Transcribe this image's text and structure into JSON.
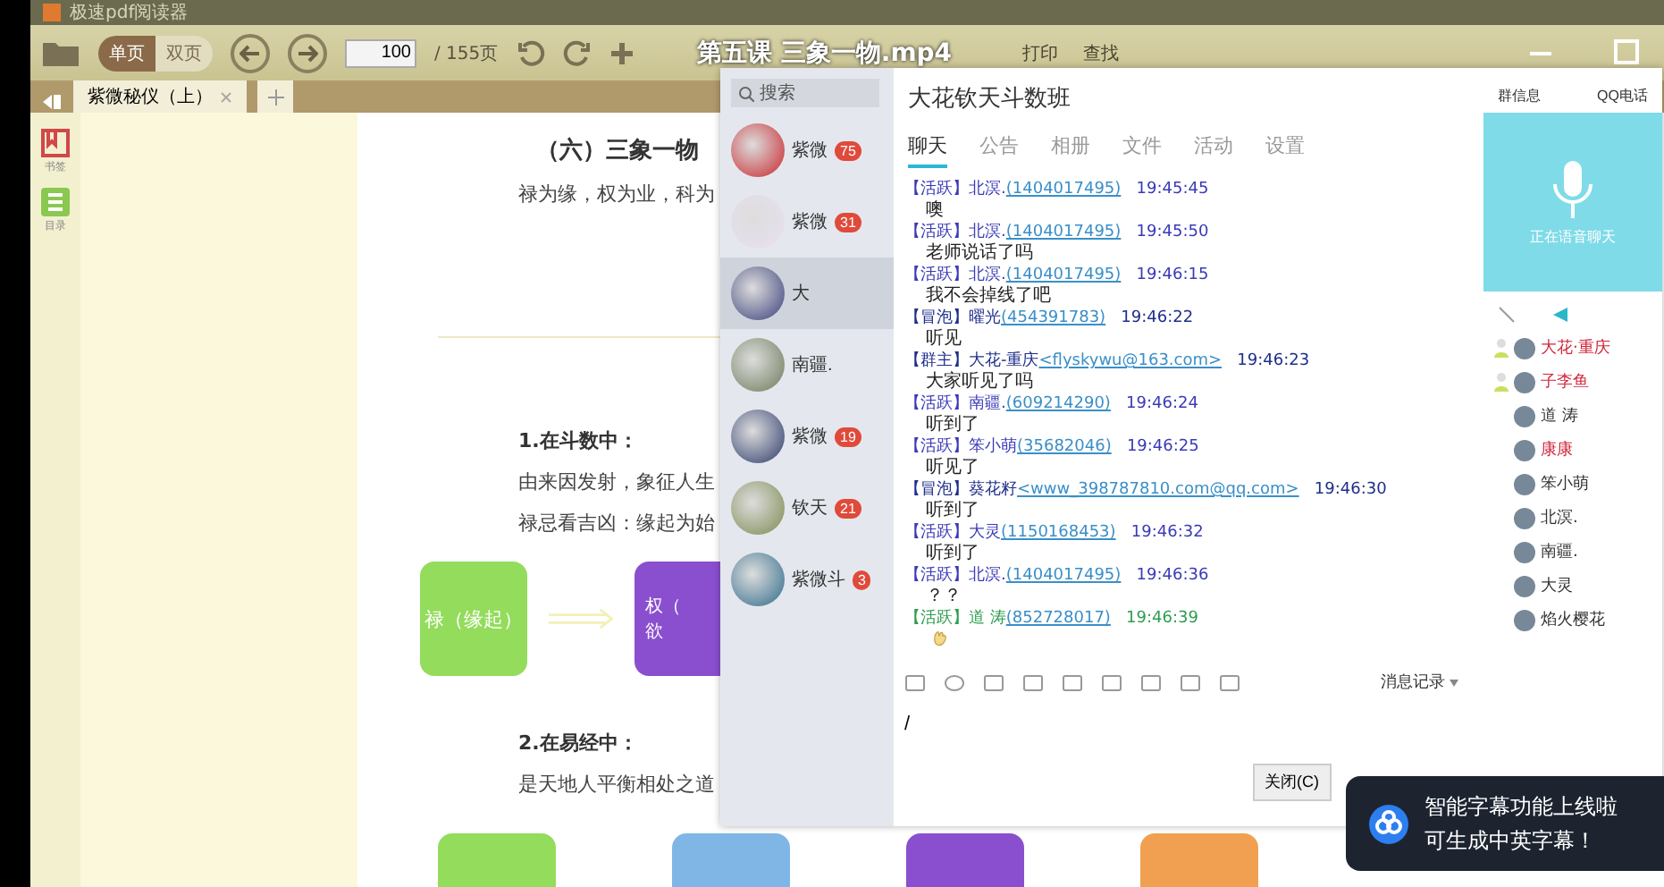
{
  "player": {
    "title": "第五课 三象一物.mp4"
  },
  "reader": {
    "app_title": "极速pdf阅读器",
    "view_modes": [
      {
        "label": "单页",
        "selected": true
      },
      {
        "label": "双页",
        "selected": false
      }
    ],
    "page_number": "100",
    "page_total": "/ 155页",
    "tools": [
      "打印",
      "查找"
    ],
    "tabs": [
      {
        "label": "紫微秘仪（上）",
        "selected": true
      }
    ],
    "sidebar": [
      "书签",
      "目录"
    ]
  },
  "document": {
    "heading": "（六）三象一物",
    "intro": "禄为缘，权为业，科为",
    "section_1": "1.在斗数中：",
    "lines_1": [
      "由来因发射，象征人生",
      "禄忌看吉凶：缘起为始"
    ],
    "diagram": [
      {
        "lines": [
          "禄（缘起）"
        ],
        "color": "#93dc5c"
      },
      {
        "lines": [
          "权（",
          "欲"
        ],
        "color": "#8a4fcf"
      }
    ],
    "section_2": "2.在易经中：",
    "line_2": "是天地人平衡相处之道",
    "bottom_boxes": [
      {
        "color": "#93dc5c"
      },
      {
        "color": "#7fb6e6"
      },
      {
        "color": "#8a4fcf"
      },
      {
        "color": "#f0a050"
      }
    ]
  },
  "chat": {
    "search_placeholder": "搜索",
    "contacts": [
      {
        "name": "紫微",
        "badge": "75",
        "selected": false
      },
      {
        "name": "紫微",
        "badge": "31",
        "selected": false
      },
      {
        "name": "大",
        "selected": true
      },
      {
        "name": "南疆.",
        "selected": false
      },
      {
        "name": "紫微",
        "badge": "19",
        "selected": false
      },
      {
        "name": "钦天",
        "badge": "21",
        "selected": false
      },
      {
        "name": "紫微斗",
        "badge": "3",
        "selected": false
      }
    ],
    "group_name": "大花钦天斗数班",
    "tabs": [
      {
        "label": "聊天",
        "selected": true
      },
      {
        "label": "公告",
        "selected": false
      },
      {
        "label": "相册",
        "selected": false
      },
      {
        "label": "文件",
        "selected": false
      },
      {
        "label": "活动",
        "selected": false
      },
      {
        "label": "设置",
        "selected": false
      }
    ],
    "messages": [
      {
        "kind": "text",
        "tag": "【活跃】",
        "sender": "北溟.",
        "contact": "(1404017495)",
        "time": "19:45:45",
        "text": "噢",
        "color": "#3a3ab8"
      },
      {
        "kind": "text",
        "tag": "【活跃】",
        "sender": "北溟.",
        "contact": "(1404017495)",
        "time": "19:45:50",
        "text": "老师说话了吗",
        "color": "#3a3ab8"
      },
      {
        "kind": "text",
        "tag": "【活跃】",
        "sender": "北溟.",
        "contact": "(1404017495)",
        "time": "19:46:15",
        "text": "我不会掉线了吧",
        "color": "#3a3ab8"
      },
      {
        "kind": "text",
        "tag": "【冒泡】",
        "sender": "曜光",
        "contact": "(454391783)",
        "time": "19:46:22",
        "text": "听见",
        "color": "#1f2f8a"
      },
      {
        "kind": "text",
        "tag": "【群主】",
        "sender": "大花-重庆",
        "contact": "<flyskywu@163.com>",
        "time": "19:46:23",
        "text": "大家听见了吗",
        "color": "#1f2f8a"
      },
      {
        "kind": "text",
        "tag": "【活跃】",
        "sender": "南疆.",
        "contact": "(609214290)",
        "time": "19:46:24",
        "text": "听到了",
        "color": "#3a3ab8"
      },
      {
        "kind": "text",
        "tag": "【活跃】",
        "sender": "笨小萌",
        "contact": "(35682046)",
        "time": "19:46:25",
        "text": "听见了",
        "color": "#3a3ab8"
      },
      {
        "kind": "text",
        "tag": "【冒泡】",
        "sender": "葵花籽",
        "contact": "<www_398787810.com@qq.com>",
        "time": "19:46:30",
        "text": "听到了",
        "color": "#1f2f8a"
      },
      {
        "kind": "text",
        "tag": "【活跃】",
        "sender": "大灵",
        "contact": "(1150168453)",
        "time": "19:46:32",
        "text": "听到了",
        "color": "#3a3ab8"
      },
      {
        "kind": "text",
        "tag": "【活跃】",
        "sender": "北溟.",
        "contact": "(1404017495)",
        "time": "19:46:36",
        "text": "？？",
        "color": "#3a3ab8"
      },
      {
        "kind": "sticker",
        "tag": "【活跃】",
        "sender": "道 涛",
        "contact": "(852728017)",
        "time": "19:46:39",
        "color": "#2e9e4f"
      }
    ],
    "side_tabs": [
      "群信息",
      "QQ电话"
    ],
    "voice_status": "正在语音聊天",
    "members": [
      {
        "name": "大花·重庆",
        "color": "#d0263b",
        "kind": "admin"
      },
      {
        "name": "子李鱼",
        "color": "#d0263b",
        "kind": "admin"
      },
      {
        "name": "道 涛",
        "color": "#333333",
        "kind": "member"
      },
      {
        "name": "康康",
        "color": "#d0263b",
        "kind": "member"
      },
      {
        "name": "笨小萌",
        "color": "#333333",
        "kind": "member"
      },
      {
        "name": "北溟.",
        "color": "#333333",
        "kind": "member"
      },
      {
        "name": "南疆.",
        "color": "#333333",
        "kind": "member"
      },
      {
        "name": "大灵",
        "color": "#333333",
        "kind": "member"
      },
      {
        "name": "焰火樱花",
        "color": "#333333",
        "kind": "member"
      }
    ],
    "history": "消息记录",
    "input_value": "/",
    "buttons": [
      "关闭(C)"
    ]
  },
  "toast": {
    "lines": [
      "智能字幕功能上线啦",
      "可生成中英字幕！"
    ]
  }
}
